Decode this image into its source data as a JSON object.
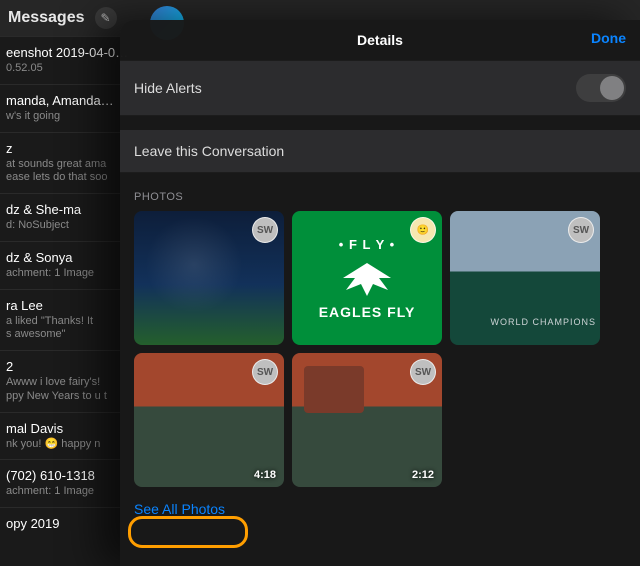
{
  "bg": {
    "app": "Messages",
    "items": [
      {
        "name": "eenshot 2019-04-0…",
        "sub": "0.52.05"
      },
      {
        "name": "manda, Amanda…",
        "sub": "w's it going"
      },
      {
        "name": "z",
        "sub": "at sounds great ama\nease lets do that soo"
      },
      {
        "name": "dz & She-ma",
        "sub": "d: NoSubject"
      },
      {
        "name": "dz & Sonya",
        "sub": "achment: 1 Image"
      },
      {
        "name": "ra Lee",
        "sub": "a liked \"Thanks! It\ns awesome\""
      },
      {
        "name": "2",
        "sub": "Awww i  love fairy's!\nppy New Years to u t"
      },
      {
        "name": "mal Davis",
        "sub": "nk you! 😁 happy n"
      },
      {
        "name": "(702) 610-1318",
        "sub": "achment: 1 Image"
      },
      {
        "name": "opy 2019",
        "sub": ""
      }
    ]
  },
  "panel": {
    "title": "Details",
    "done": "Done",
    "hideAlerts": "Hide Alerts",
    "leave": "Leave this Conversation",
    "photosHeader": "PHOTOS",
    "seeAll": "See All Photos",
    "badges": {
      "sw": "SW"
    },
    "eagles": {
      "top": "• F L Y •",
      "bottom": "EAGLES FLY"
    },
    "champ": "WORLD\nCHAMPIONS",
    "thumbs": [
      {
        "badge": "sw",
        "dur": ""
      },
      {
        "badge": "face",
        "dur": ""
      },
      {
        "badge": "sw",
        "dur": ""
      },
      {
        "badge": "sw",
        "dur": "4:18"
      },
      {
        "badge": "sw",
        "dur": "2:12"
      }
    ]
  }
}
